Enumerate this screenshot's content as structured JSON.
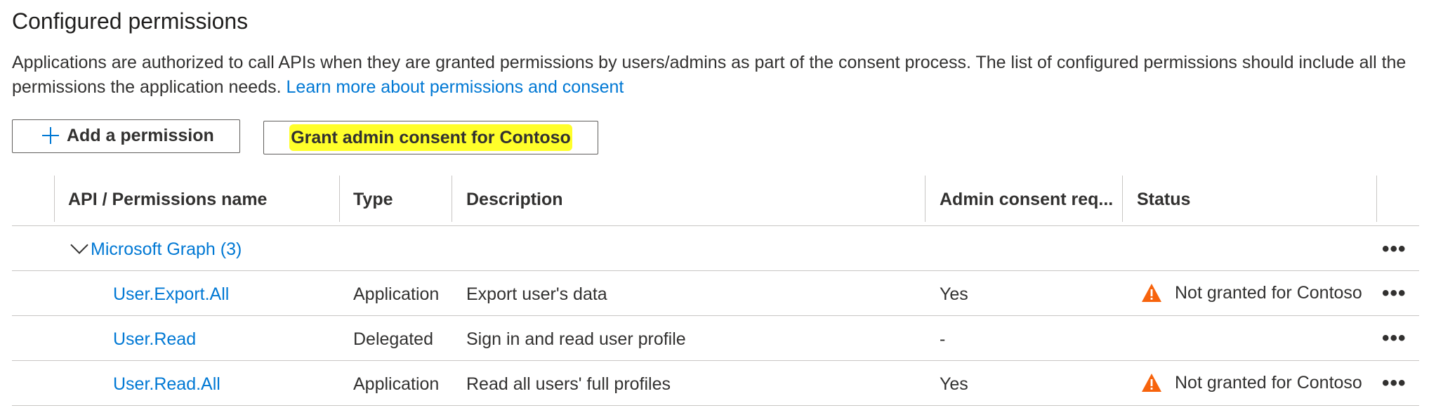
{
  "title": "Configured permissions",
  "description": {
    "text": "Applications are authorized to call APIs when they are granted permissions by users/admins as part of the consent process. The list of configured permissions should include all the permissions the application needs.",
    "link": "Learn more about permissions and consent"
  },
  "toolbar": {
    "add_label": "Add a permission",
    "grant_label": "Grant admin consent for Contoso"
  },
  "table": {
    "columns": [
      "API / Permissions name",
      "Type",
      "Description",
      "Admin consent req...",
      "Status"
    ],
    "group": {
      "label": "Microsoft Graph (3)"
    },
    "rows": [
      {
        "name": "User.Export.All",
        "type": "Application",
        "description": "Export user's data",
        "admin": "Yes",
        "status": "Not granted for Contoso",
        "status_icon": "warning-icon"
      },
      {
        "name": "User.Read",
        "type": "Delegated",
        "description": "Sign in and read user profile",
        "admin": "-",
        "status": "",
        "status_icon": ""
      },
      {
        "name": "User.Read.All",
        "type": "Application",
        "description": "Read all users' full profiles",
        "admin": "Yes",
        "status": "Not granted for Contoso",
        "status_icon": "warning-icon"
      }
    ],
    "more_label": "•••"
  },
  "colors": {
    "link": "#0078d4",
    "warning": "#f7630c",
    "highlight": "#ffff2a"
  }
}
